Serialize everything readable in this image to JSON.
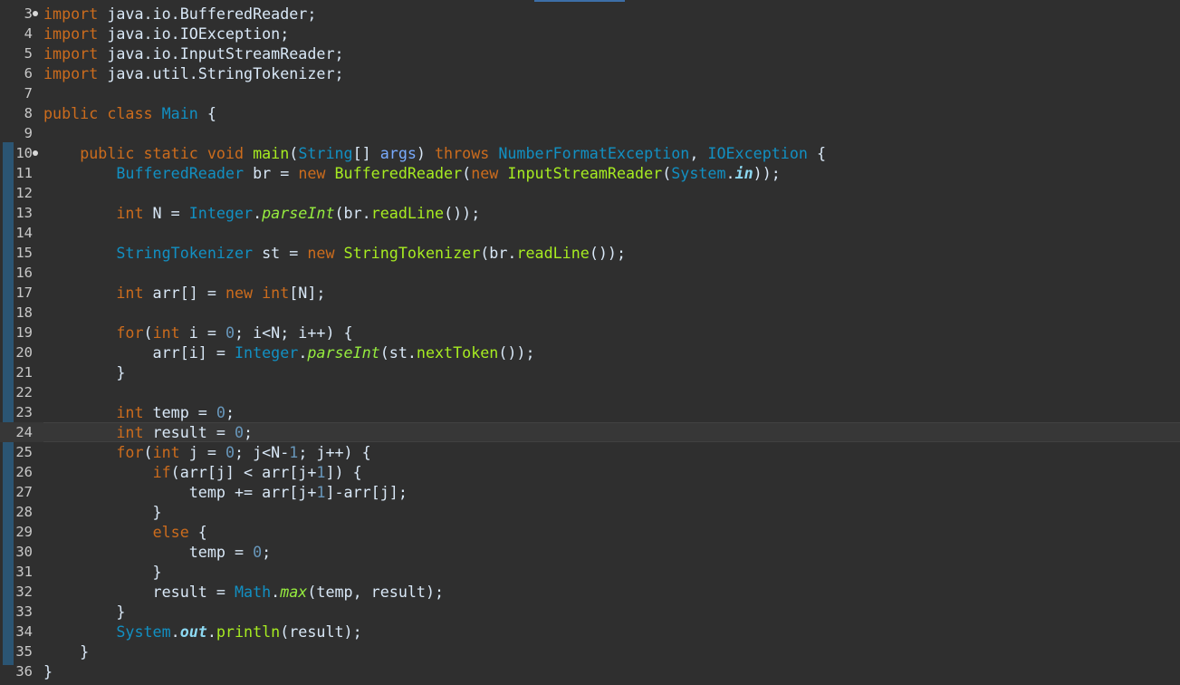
{
  "editor": {
    "colors": {
      "background": "#2f2f2f",
      "current_line": "#373737",
      "keyword": "#cc6c1d",
      "type": "#1290c3",
      "method": "#a7ec21",
      "number": "#6897bb",
      "static_method": "#96ec3f",
      "static_field": "#8dd9f2",
      "parameter": "#79abff",
      "plain": "#d9e8f7",
      "line_number": "#c8c8c8"
    },
    "current_line_number": "24",
    "lines": [
      {
        "num": "3",
        "fold": true,
        "tokens": [
          {
            "t": "import",
            "k": "keyword"
          },
          {
            "t": " java.io.BufferedReader;",
            "k": "plain"
          }
        ]
      },
      {
        "num": "4",
        "fold": false,
        "tokens": [
          {
            "t": "import",
            "k": "keyword"
          },
          {
            "t": " java.io.IOException;",
            "k": "plain"
          }
        ]
      },
      {
        "num": "5",
        "fold": false,
        "tokens": [
          {
            "t": "import",
            "k": "keyword"
          },
          {
            "t": " java.io.InputStreamReader;",
            "k": "plain"
          }
        ]
      },
      {
        "num": "6",
        "fold": false,
        "tokens": [
          {
            "t": "import",
            "k": "keyword"
          },
          {
            "t": " java.util.StringTokenizer;",
            "k": "plain"
          }
        ]
      },
      {
        "num": "7",
        "fold": false,
        "tokens": []
      },
      {
        "num": "8",
        "fold": false,
        "tokens": [
          {
            "t": "public",
            "k": "keyword"
          },
          {
            "t": " ",
            "k": "plain"
          },
          {
            "t": "class",
            "k": "keyword"
          },
          {
            "t": " ",
            "k": "plain"
          },
          {
            "t": "Main",
            "k": "type"
          },
          {
            "t": " {",
            "k": "plain"
          }
        ]
      },
      {
        "num": "9",
        "fold": false,
        "tokens": []
      },
      {
        "num": "10",
        "fold": true,
        "tokens": [
          {
            "t": "    ",
            "k": "plain"
          },
          {
            "t": "public",
            "k": "keyword"
          },
          {
            "t": " ",
            "k": "plain"
          },
          {
            "t": "static",
            "k": "keyword"
          },
          {
            "t": " ",
            "k": "plain"
          },
          {
            "t": "void",
            "k": "keyword"
          },
          {
            "t": " ",
            "k": "plain"
          },
          {
            "t": "main",
            "k": "method"
          },
          {
            "t": "(",
            "k": "plain"
          },
          {
            "t": "String",
            "k": "type"
          },
          {
            "t": "[] ",
            "k": "plain"
          },
          {
            "t": "args",
            "k": "param"
          },
          {
            "t": ") ",
            "k": "plain"
          },
          {
            "t": "throws",
            "k": "keyword"
          },
          {
            "t": " ",
            "k": "plain"
          },
          {
            "t": "NumberFormatException",
            "k": "type"
          },
          {
            "t": ", ",
            "k": "plain"
          },
          {
            "t": "IOException",
            "k": "type"
          },
          {
            "t": " {",
            "k": "plain"
          }
        ]
      },
      {
        "num": "11",
        "fold": false,
        "tokens": [
          {
            "t": "        ",
            "k": "plain"
          },
          {
            "t": "BufferedReader",
            "k": "type"
          },
          {
            "t": " br = ",
            "k": "plain"
          },
          {
            "t": "new",
            "k": "keyword"
          },
          {
            "t": " ",
            "k": "plain"
          },
          {
            "t": "BufferedReader",
            "k": "method"
          },
          {
            "t": "(",
            "k": "plain"
          },
          {
            "t": "new",
            "k": "keyword"
          },
          {
            "t": " ",
            "k": "plain"
          },
          {
            "t": "InputStreamReader",
            "k": "method"
          },
          {
            "t": "(",
            "k": "plain"
          },
          {
            "t": "System",
            "k": "type"
          },
          {
            "t": ".",
            "k": "plain"
          },
          {
            "t": "in",
            "k": "field"
          },
          {
            "t": "));",
            "k": "plain"
          }
        ]
      },
      {
        "num": "12",
        "fold": false,
        "tokens": []
      },
      {
        "num": "13",
        "fold": false,
        "tokens": [
          {
            "t": "        ",
            "k": "plain"
          },
          {
            "t": "int",
            "k": "keyword"
          },
          {
            "t": " N = ",
            "k": "plain"
          },
          {
            "t": "Integer",
            "k": "type"
          },
          {
            "t": ".",
            "k": "plain"
          },
          {
            "t": "parseInt",
            "k": "static"
          },
          {
            "t": "(br.",
            "k": "plain"
          },
          {
            "t": "readLine",
            "k": "method"
          },
          {
            "t": "());",
            "k": "plain"
          }
        ]
      },
      {
        "num": "14",
        "fold": false,
        "tokens": []
      },
      {
        "num": "15",
        "fold": false,
        "tokens": [
          {
            "t": "        ",
            "k": "plain"
          },
          {
            "t": "StringTokenizer",
            "k": "type"
          },
          {
            "t": " st = ",
            "k": "plain"
          },
          {
            "t": "new",
            "k": "keyword"
          },
          {
            "t": " ",
            "k": "plain"
          },
          {
            "t": "StringTokenizer",
            "k": "method"
          },
          {
            "t": "(br.",
            "k": "plain"
          },
          {
            "t": "readLine",
            "k": "method"
          },
          {
            "t": "());",
            "k": "plain"
          }
        ]
      },
      {
        "num": "16",
        "fold": false,
        "tokens": []
      },
      {
        "num": "17",
        "fold": false,
        "tokens": [
          {
            "t": "        ",
            "k": "plain"
          },
          {
            "t": "int",
            "k": "keyword"
          },
          {
            "t": " arr[] = ",
            "k": "plain"
          },
          {
            "t": "new",
            "k": "keyword"
          },
          {
            "t": " ",
            "k": "plain"
          },
          {
            "t": "int",
            "k": "keyword"
          },
          {
            "t": "[N];",
            "k": "plain"
          }
        ]
      },
      {
        "num": "18",
        "fold": false,
        "tokens": []
      },
      {
        "num": "19",
        "fold": false,
        "tokens": [
          {
            "t": "        ",
            "k": "plain"
          },
          {
            "t": "for",
            "k": "keyword"
          },
          {
            "t": "(",
            "k": "plain"
          },
          {
            "t": "int",
            "k": "keyword"
          },
          {
            "t": " i = ",
            "k": "plain"
          },
          {
            "t": "0",
            "k": "number"
          },
          {
            "t": "; i<N; i++) {",
            "k": "plain"
          }
        ]
      },
      {
        "num": "20",
        "fold": false,
        "tokens": [
          {
            "t": "            arr[i] = ",
            "k": "plain"
          },
          {
            "t": "Integer",
            "k": "type"
          },
          {
            "t": ".",
            "k": "plain"
          },
          {
            "t": "parseInt",
            "k": "static"
          },
          {
            "t": "(st.",
            "k": "plain"
          },
          {
            "t": "nextToken",
            "k": "method"
          },
          {
            "t": "());",
            "k": "plain"
          }
        ]
      },
      {
        "num": "21",
        "fold": false,
        "tokens": [
          {
            "t": "        }",
            "k": "plain"
          }
        ]
      },
      {
        "num": "22",
        "fold": false,
        "tokens": []
      },
      {
        "num": "23",
        "fold": false,
        "tokens": [
          {
            "t": "        ",
            "k": "plain"
          },
          {
            "t": "int",
            "k": "keyword"
          },
          {
            "t": " temp = ",
            "k": "plain"
          },
          {
            "t": "0",
            "k": "number"
          },
          {
            "t": ";",
            "k": "plain"
          }
        ]
      },
      {
        "num": "24",
        "fold": false,
        "tokens": [
          {
            "t": "        ",
            "k": "plain"
          },
          {
            "t": "int",
            "k": "keyword"
          },
          {
            "t": " result = ",
            "k": "plain"
          },
          {
            "t": "0",
            "k": "number"
          },
          {
            "t": ";",
            "k": "plain"
          }
        ]
      },
      {
        "num": "25",
        "fold": false,
        "tokens": [
          {
            "t": "        ",
            "k": "plain"
          },
          {
            "t": "for",
            "k": "keyword"
          },
          {
            "t": "(",
            "k": "plain"
          },
          {
            "t": "int",
            "k": "keyword"
          },
          {
            "t": " j = ",
            "k": "plain"
          },
          {
            "t": "0",
            "k": "number"
          },
          {
            "t": "; j<N-",
            "k": "plain"
          },
          {
            "t": "1",
            "k": "number"
          },
          {
            "t": "; j++) {",
            "k": "plain"
          }
        ]
      },
      {
        "num": "26",
        "fold": false,
        "tokens": [
          {
            "t": "            ",
            "k": "plain"
          },
          {
            "t": "if",
            "k": "keyword"
          },
          {
            "t": "(arr[j] < arr[j+",
            "k": "plain"
          },
          {
            "t": "1",
            "k": "number"
          },
          {
            "t": "]) {",
            "k": "plain"
          }
        ]
      },
      {
        "num": "27",
        "fold": false,
        "tokens": [
          {
            "t": "                temp += arr[j+",
            "k": "plain"
          },
          {
            "t": "1",
            "k": "number"
          },
          {
            "t": "]-arr[j];",
            "k": "plain"
          }
        ]
      },
      {
        "num": "28",
        "fold": false,
        "tokens": [
          {
            "t": "            }",
            "k": "plain"
          }
        ]
      },
      {
        "num": "29",
        "fold": false,
        "tokens": [
          {
            "t": "            ",
            "k": "plain"
          },
          {
            "t": "else",
            "k": "keyword"
          },
          {
            "t": " {",
            "k": "plain"
          }
        ]
      },
      {
        "num": "30",
        "fold": false,
        "tokens": [
          {
            "t": "                temp = ",
            "k": "plain"
          },
          {
            "t": "0",
            "k": "number"
          },
          {
            "t": ";",
            "k": "plain"
          }
        ]
      },
      {
        "num": "31",
        "fold": false,
        "tokens": [
          {
            "t": "            }",
            "k": "plain"
          }
        ]
      },
      {
        "num": "32",
        "fold": false,
        "tokens": [
          {
            "t": "            result = ",
            "k": "plain"
          },
          {
            "t": "Math",
            "k": "type"
          },
          {
            "t": ".",
            "k": "plain"
          },
          {
            "t": "max",
            "k": "static"
          },
          {
            "t": "(temp, result);",
            "k": "plain"
          }
        ]
      },
      {
        "num": "33",
        "fold": false,
        "tokens": [
          {
            "t": "        }",
            "k": "plain"
          }
        ]
      },
      {
        "num": "34",
        "fold": false,
        "tokens": [
          {
            "t": "        ",
            "k": "plain"
          },
          {
            "t": "System",
            "k": "type"
          },
          {
            "t": ".",
            "k": "plain"
          },
          {
            "t": "out",
            "k": "field"
          },
          {
            "t": ".",
            "k": "plain"
          },
          {
            "t": "println",
            "k": "method"
          },
          {
            "t": "(result);",
            "k": "plain"
          }
        ]
      },
      {
        "num": "35",
        "fold": false,
        "tokens": [
          {
            "t": "    }",
            "k": "plain"
          }
        ]
      },
      {
        "num": "36",
        "fold": false,
        "tokens": [
          {
            "t": "}",
            "k": "plain"
          }
        ]
      }
    ]
  }
}
